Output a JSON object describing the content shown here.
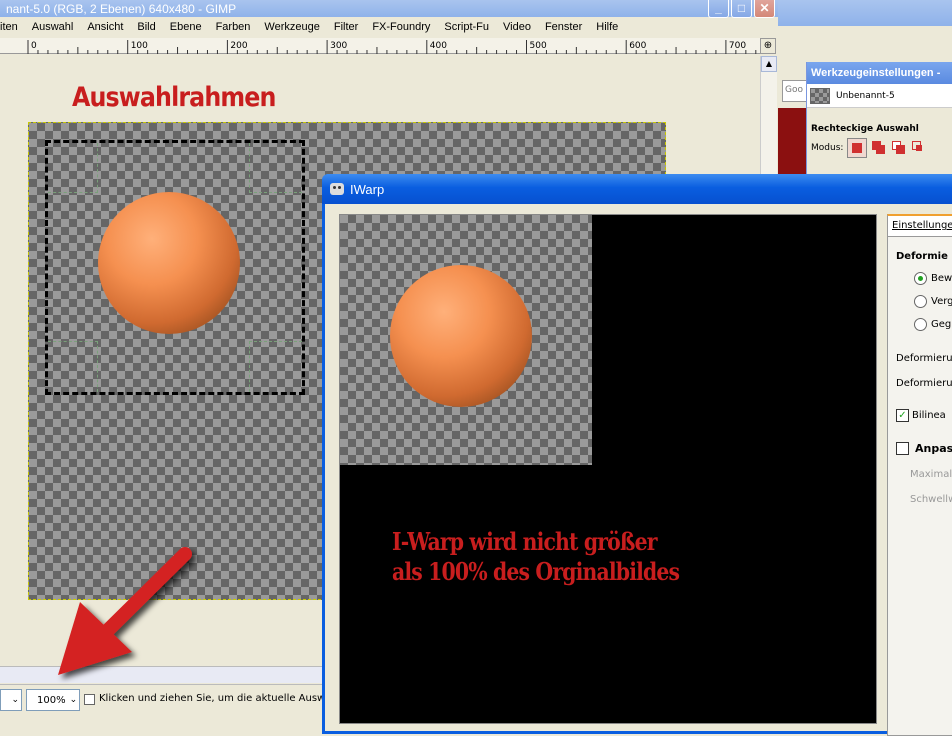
{
  "gimp": {
    "title": "nant-5.0 (RGB, 2 Ebenen) 640x480 - GIMP",
    "menu": [
      "iten",
      "Auswahl",
      "Ansicht",
      "Bild",
      "Ebene",
      "Farben",
      "Werkzeuge",
      "Filter",
      "FX-Foundry",
      "Script-Fu",
      "Video",
      "Fenster",
      "Hilfe"
    ],
    "ruler": [
      "0",
      "100",
      "200",
      "300",
      "400",
      "500",
      "600",
      "700"
    ],
    "canvas_title": "Auswahlrahmen",
    "zoom": "100%",
    "status": "Klicken und ziehen Sie, um die aktuelle Auswah"
  },
  "tool_options": {
    "title": "Werkzeugeinstellungen -",
    "image_name": "Unbenannt-5",
    "tool_name": "Rechteckige Auswahl",
    "mode_label": "Modus:",
    "search_text": "Goo"
  },
  "iwarp": {
    "title": "IWarp",
    "preview_note_line1": "I-Warp wird nicht größer",
    "preview_note_line2": "als 100% des Orginalbildes",
    "tab": "Einstellunge",
    "section": "Deformie",
    "radios": [
      "Bew",
      "Verg",
      "Geg"
    ],
    "deform_label1": "Deformieru",
    "deform_label2": "Deformieru",
    "bilinear": "Bilinea",
    "adaptive": "Anpas",
    "max_label": "Maximale",
    "threshold_label": "Schwellw"
  },
  "colors": {
    "accent_red": "#c81e1e",
    "xp_blue": "#0a5ee0"
  }
}
